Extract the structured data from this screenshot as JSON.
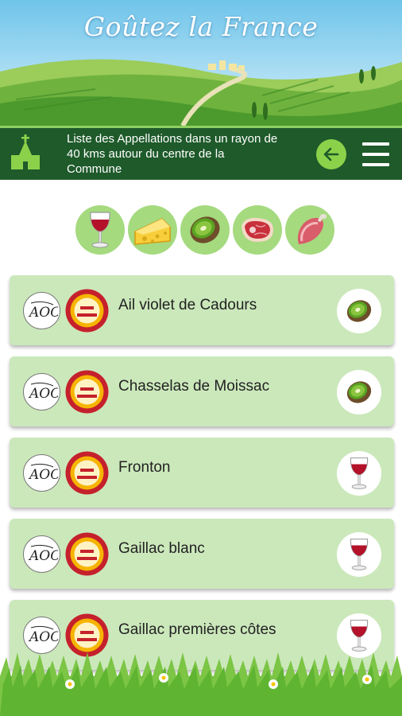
{
  "app": {
    "title": "Goûtez la France"
  },
  "toolbar": {
    "description": "Liste des Appellations dans un rayon de 40 kms autour du centre de la Commune",
    "left_icon": "church-icon",
    "back_icon": "arrow-left-icon",
    "menu_icon": "hamburger-menu-icon"
  },
  "filters": [
    {
      "name": "wine",
      "icon": "wine-glass-icon"
    },
    {
      "name": "cheese",
      "icon": "cheese-icon"
    },
    {
      "name": "fruit",
      "icon": "kiwi-icon"
    },
    {
      "name": "meat",
      "icon": "steak-icon"
    },
    {
      "name": "charcuterie",
      "icon": "ham-icon"
    }
  ],
  "appellations": [
    {
      "label": "Ail violet de Cadours",
      "category_icon": "kiwi-icon"
    },
    {
      "label": "Chasselas de Moissac",
      "category_icon": "kiwi-icon"
    },
    {
      "label": "Fronton",
      "category_icon": "wine-glass-icon"
    },
    {
      "label": "Gaillac blanc",
      "category_icon": "wine-glass-icon"
    },
    {
      "label": "Gaillac premières côtes",
      "category_icon": "wine-glass-icon"
    }
  ],
  "badges": {
    "aoc_icon": "aoc-logo-icon",
    "aop_icon": "aop-seal-icon"
  },
  "colors": {
    "toolbar": "#1e5a2a",
    "accent": "#8bd24a",
    "card": "#cbe8bb",
    "chip": "#a5da7f"
  }
}
